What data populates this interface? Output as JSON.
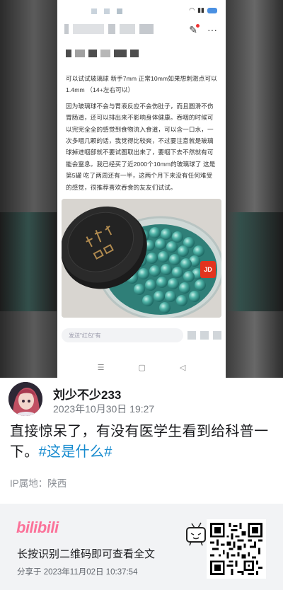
{
  "screenshot": {
    "post_text_1": "可以试试玻璃球 新手7mm 正常10mm如果想刺激点可以1.4mm （14+左右可以）",
    "post_text_2": "因为玻璃球不会与胃液反应不会伤肚子，而且圆滑不伤胃肠道，还可以排出来不影响身体健康。吞咽的时候可以完完全全的感觉到食物流入食道，可以含一口水，一次多咽几颗的话，我觉得比较爽，不过要注意就是玻璃球掉进咽部就不要试图取出来了，要咽下去不然就有可能会窒息。我已经买了近2000个10mm的玻璃球了 这是第5罐 吃了两周还有一半，这两个月下来没有任何难受的感觉，很推荐喜欢吞食的友友们试试。",
    "comment_placeholder": "发送\"红包\"有",
    "jd_badge": "JD"
  },
  "author": {
    "name": "刘少不少233",
    "time": "2023年10月30日 19:27"
  },
  "content": {
    "text": "直接惊呆了，有没有医学生看到给科普一下。",
    "hashtag": "#这是什么#"
  },
  "ip_location": "IP属地：陕西",
  "footer": {
    "logo": "bilibili",
    "tip": "长按识别二维码即可查看全文",
    "share_time": "分享于 2023年11月02日 10:37:54"
  },
  "colors": {
    "accent_pink": "#fb7299",
    "hashtag_blue": "#178bcf",
    "footer_bg": "#f2f3f5"
  }
}
